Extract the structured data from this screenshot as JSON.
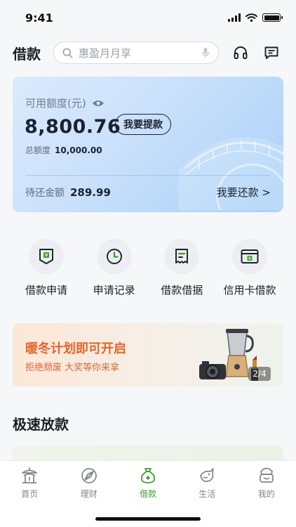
{
  "status_bar": {
    "time": "9:41"
  },
  "header": {
    "title": "借款",
    "search_placeholder": "惠盈月月享",
    "icons": [
      "search-icon",
      "mic-icon",
      "headset-icon",
      "message-icon"
    ]
  },
  "credit": {
    "available_label": "可用额度(元)",
    "available_amount": "8,800.76",
    "withdraw_label": "我要提款",
    "total_label": "总额度",
    "total_amount": "10,000.00",
    "pending_label": "待还金额",
    "pending_amount": "289.99",
    "repay_label": "我要还款 >"
  },
  "quick_actions": [
    {
      "label": "借款申请",
      "icon": "loan-apply-icon"
    },
    {
      "label": "申请记录",
      "icon": "clock-icon"
    },
    {
      "label": "借款借据",
      "icon": "receipt-icon"
    },
    {
      "label": "信用卡借款",
      "icon": "credit-card-icon"
    }
  ],
  "promo": {
    "title": "暖冬计划即可开启",
    "subtitle": "拒绝颓废   大奖等你来拿",
    "page_indicator": "2/4"
  },
  "section": {
    "title": "极速放款"
  },
  "tabs": [
    {
      "label": "首页",
      "icon": "pavilion-icon",
      "active": false
    },
    {
      "label": "理财",
      "icon": "compass-icon",
      "active": false
    },
    {
      "label": "借款",
      "icon": "money-bag-icon",
      "active": true
    },
    {
      "label": "生活",
      "icon": "fish-icon",
      "active": false
    },
    {
      "label": "我的",
      "icon": "profile-icon",
      "active": false
    }
  ],
  "colors": {
    "accent": "#3f9a2e",
    "promo": "#e5642c",
    "card_gradient_end": "#a9d1f7"
  }
}
